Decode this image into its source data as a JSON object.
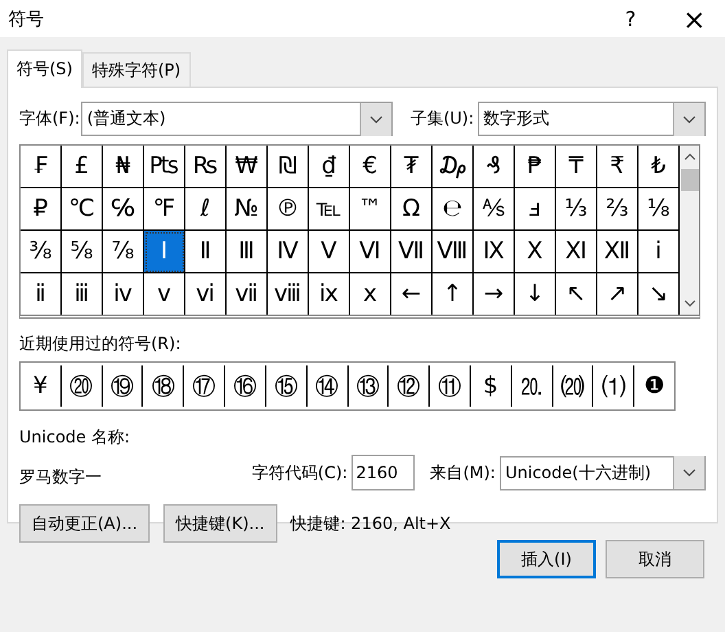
{
  "window": {
    "title": "符号",
    "help": "?",
    "close": "×"
  },
  "tabs": [
    {
      "label": "符号(S)",
      "selected": true
    },
    {
      "label": "特殊字符(P)",
      "selected": false
    }
  ],
  "font": {
    "label": "字体(F):",
    "value": "(普通文本)"
  },
  "subset": {
    "label": "子集(U):",
    "value": "数字形式"
  },
  "symbols": [
    {
      "char": "₣",
      "selected": false
    },
    {
      "char": "£",
      "selected": false
    },
    {
      "char": "₦",
      "selected": false
    },
    {
      "char": "₧",
      "selected": false
    },
    {
      "char": "₨",
      "selected": false
    },
    {
      "char": "₩",
      "selected": false
    },
    {
      "char": "₪",
      "selected": false
    },
    {
      "char": "₫",
      "selected": false
    },
    {
      "char": "€",
      "selected": false
    },
    {
      "char": "₮",
      "selected": false
    },
    {
      "char": "₯",
      "selected": false
    },
    {
      "char": "₰",
      "selected": false
    },
    {
      "char": "₱",
      "selected": false
    },
    {
      "char": "₸",
      "selected": false
    },
    {
      "char": "₹",
      "selected": false
    },
    {
      "char": "₺",
      "selected": false
    },
    {
      "char": "₽",
      "selected": false
    },
    {
      "char": "℃",
      "selected": false
    },
    {
      "char": "℅",
      "selected": false
    },
    {
      "char": "℉",
      "selected": false
    },
    {
      "char": "ℓ",
      "selected": false
    },
    {
      "char": "№",
      "selected": false
    },
    {
      "char": "℗",
      "selected": false
    },
    {
      "char": "℡",
      "selected": false
    },
    {
      "char": "™",
      "selected": false
    },
    {
      "char": "Ω",
      "selected": false
    },
    {
      "char": "℮",
      "selected": false
    },
    {
      "char": "⅍",
      "selected": false
    },
    {
      "char": "ⅎ",
      "selected": false
    },
    {
      "char": "⅓",
      "selected": false
    },
    {
      "char": "⅔",
      "selected": false
    },
    {
      "char": "⅛",
      "selected": false
    },
    {
      "char": "⅜",
      "selected": false
    },
    {
      "char": "⅝",
      "selected": false
    },
    {
      "char": "⅞",
      "selected": false
    },
    {
      "char": "Ⅰ",
      "selected": true
    },
    {
      "char": "Ⅱ",
      "selected": false
    },
    {
      "char": "Ⅲ",
      "selected": false
    },
    {
      "char": "Ⅳ",
      "selected": false
    },
    {
      "char": "Ⅴ",
      "selected": false
    },
    {
      "char": "Ⅵ",
      "selected": false
    },
    {
      "char": "Ⅶ",
      "selected": false
    },
    {
      "char": "Ⅷ",
      "selected": false
    },
    {
      "char": "Ⅸ",
      "selected": false
    },
    {
      "char": "Ⅹ",
      "selected": false
    },
    {
      "char": "Ⅺ",
      "selected": false
    },
    {
      "char": "Ⅻ",
      "selected": false
    },
    {
      "char": "ⅰ",
      "selected": false
    },
    {
      "char": "ⅱ",
      "selected": false
    },
    {
      "char": "ⅲ",
      "selected": false
    },
    {
      "char": "ⅳ",
      "selected": false
    },
    {
      "char": "ⅴ",
      "selected": false
    },
    {
      "char": "ⅵ",
      "selected": false
    },
    {
      "char": "ⅶ",
      "selected": false
    },
    {
      "char": "ⅷ",
      "selected": false
    },
    {
      "char": "ⅸ",
      "selected": false
    },
    {
      "char": "ⅹ",
      "selected": false
    },
    {
      "char": "←",
      "selected": false
    },
    {
      "char": "↑",
      "selected": false
    },
    {
      "char": "→",
      "selected": false
    },
    {
      "char": "↓",
      "selected": false
    },
    {
      "char": "↖",
      "selected": false
    },
    {
      "char": "↗",
      "selected": false
    },
    {
      "char": "↘",
      "selected": false
    }
  ],
  "recent": {
    "label": "近期使用过的符号(R):",
    "symbols": [
      "¥",
      "⑳",
      "⑲",
      "⑱",
      "⑰",
      "⑯",
      "⑮",
      "⑭",
      "⑬",
      "⑫",
      "⑪",
      "$",
      "⒛",
      "⒇",
      "⑴",
      "❶"
    ]
  },
  "unicode_name": {
    "label": "Unicode 名称:",
    "value": "罗马数字一"
  },
  "char_code": {
    "label": "字符代码(C):",
    "value": "2160"
  },
  "from": {
    "label": "来自(M):",
    "value": "Unicode(十六进制)"
  },
  "buttons": [
    {
      "label": "自动更正(A)..."
    },
    {
      "label": "快捷键(K)..."
    }
  ],
  "shortcut": "快捷键: 2160, Alt+X",
  "actions": [
    {
      "label": "插入(I)",
      "default": true
    },
    {
      "label": "取消",
      "default": false
    }
  ]
}
